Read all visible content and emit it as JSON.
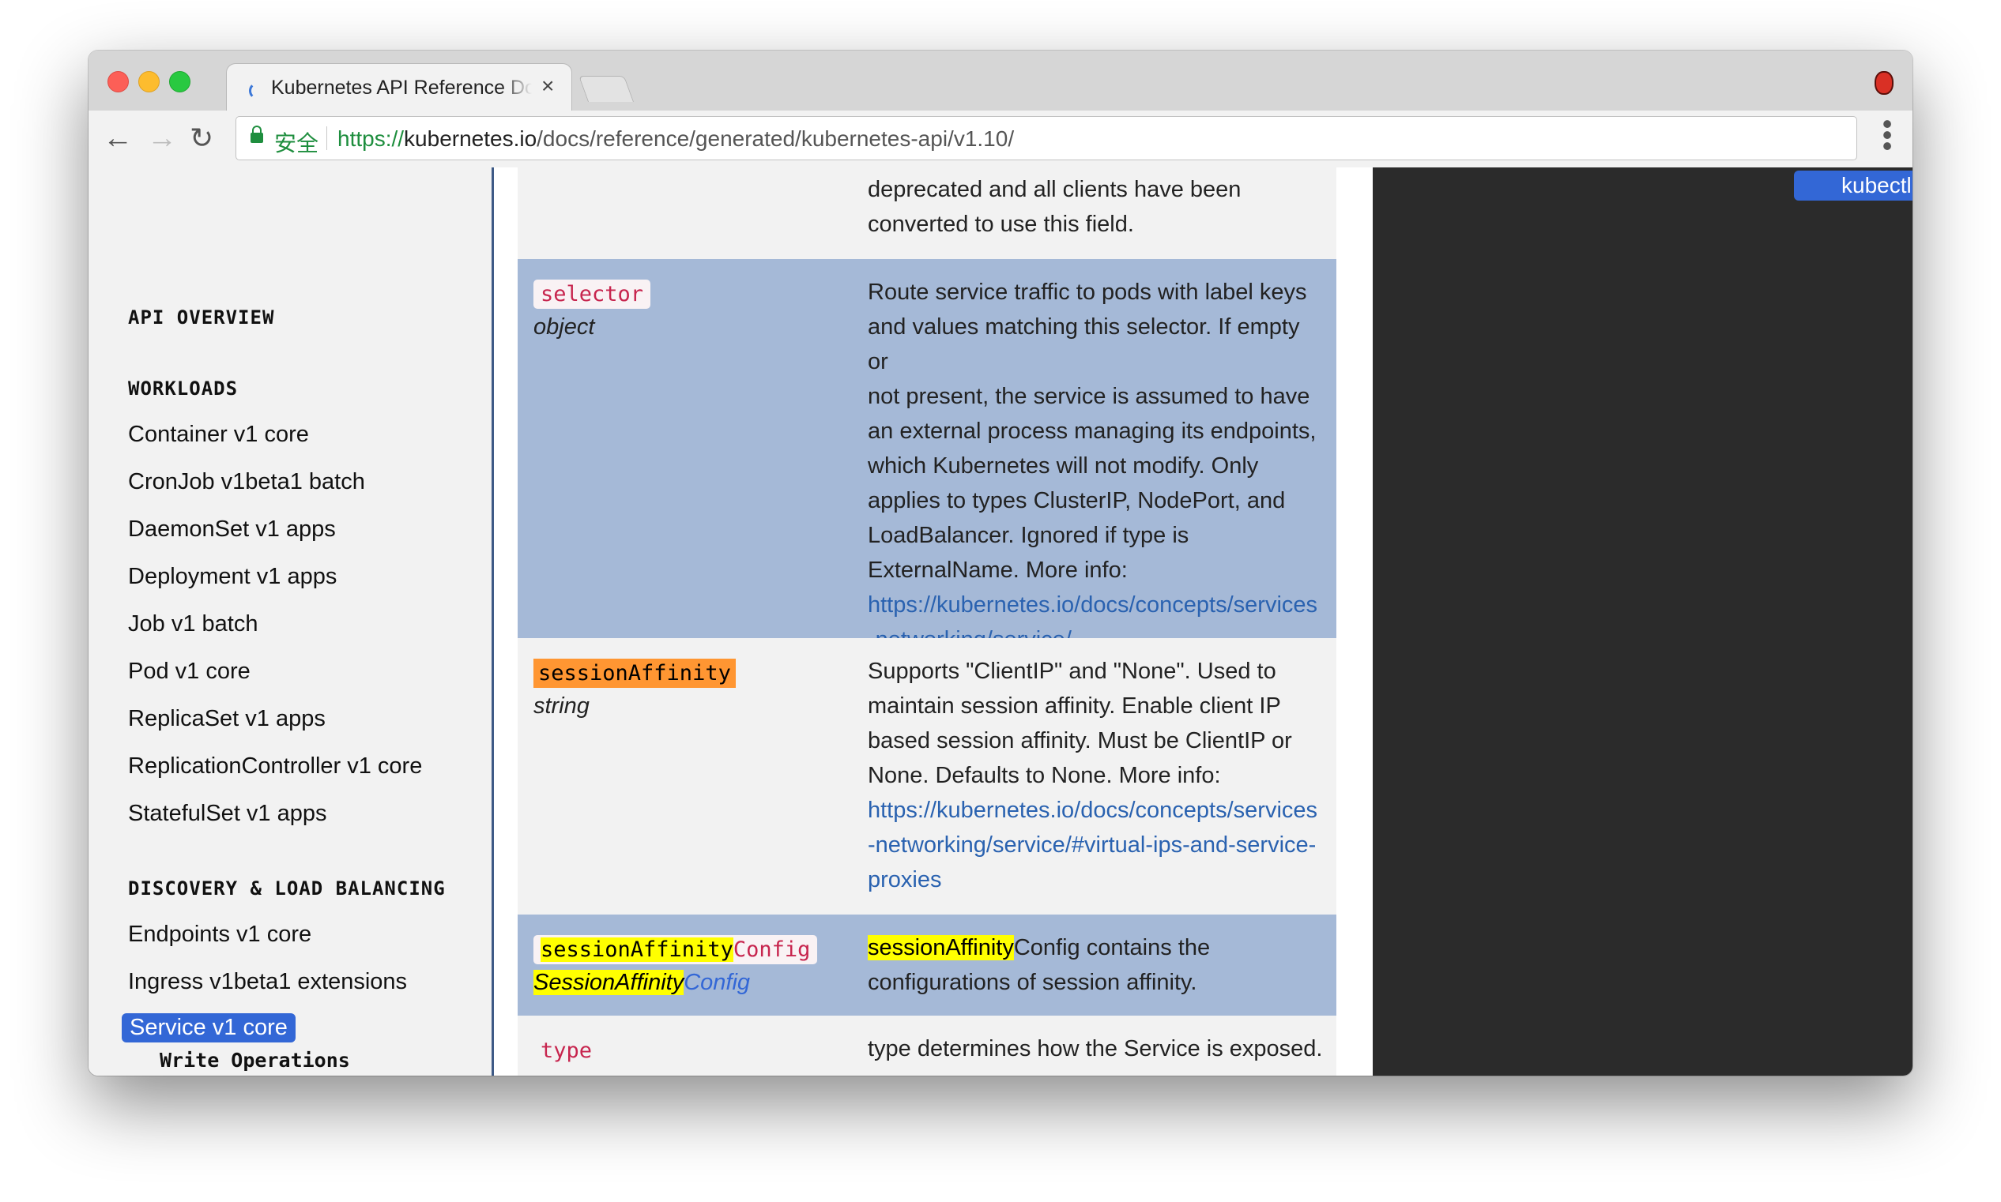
{
  "browser": {
    "tab_title": "Kubernetes API Reference Doc",
    "tab_close": "×",
    "secure_label": "安全",
    "url_scheme": "https://",
    "url_host": "kubernetes.io",
    "url_path": "/docs/reference/generated/kubernetes-api/v1.10/"
  },
  "sidebar": {
    "headings": {
      "api_overview": "API OVERVIEW",
      "workloads": "WORKLOADS",
      "discovery": "DISCOVERY & LOAD BALANCING"
    },
    "workloads_items": [
      "Container v1 core",
      "CronJob v1beta1 batch",
      "DaemonSet v1 apps",
      "Deployment v1 apps",
      "Job v1 batch",
      "Pod v1 core",
      "ReplicaSet v1 apps",
      "ReplicationController v1 core",
      "StatefulSet v1 apps"
    ],
    "discovery_items": [
      "Endpoints v1 core",
      "Ingress v1beta1 extensions",
      "Service v1 core"
    ],
    "active_item": "Service v1 core",
    "sub_item": "Write Operations"
  },
  "fields": {
    "top_desc_1": "deprecated and all clients have been",
    "top_desc_2": "converted to use this field.",
    "selector": {
      "name": "selector",
      "type": "object",
      "desc_lines": [
        "Route service traffic to pods with label keys",
        "and values matching this selector. If empty or",
        "not present, the service is assumed to have",
        "an external process managing its endpoints,",
        "which Kubernetes will not modify. Only",
        "applies to types ClusterIP, NodePort, and",
        "LoadBalancer. Ignored if type is",
        "ExternalName. More info:"
      ],
      "link_lines": [
        "https://kubernetes.io/docs/concepts/services",
        "-networking/service/"
      ]
    },
    "sessionAffinity": {
      "name": "sessionAffinity",
      "type": "string",
      "desc_lines": [
        "Supports \"ClientIP\" and \"None\". Used to",
        "maintain session affinity. Enable client IP",
        "based session affinity. Must be ClientIP or",
        "None. Defaults to None. More info:"
      ],
      "link_lines": [
        "https://kubernetes.io/docs/concepts/services",
        "-networking/service/#virtual-ips-and-service-",
        "proxies"
      ]
    },
    "sessionAffinityConfig": {
      "name_hl": "sessionAffinity",
      "name_rest": "Config",
      "type_hl": "SessionAffinity",
      "type_rest": "Config",
      "desc_hl": "sessionAffinity",
      "desc_rest_1": "Config contains the",
      "desc_line_2": "configurations of session affinity."
    },
    "type": {
      "name": "type",
      "desc_line_1": "type determines how the Service is exposed."
    }
  },
  "right_panel": {
    "tab_label": "kubectl"
  },
  "colors": {
    "accent": "#3367d6",
    "row_blue": "#a5b9d7",
    "highlight_yellow": "#ffff00",
    "highlight_orange": "#ff9632",
    "code_red": "#c7254e"
  }
}
